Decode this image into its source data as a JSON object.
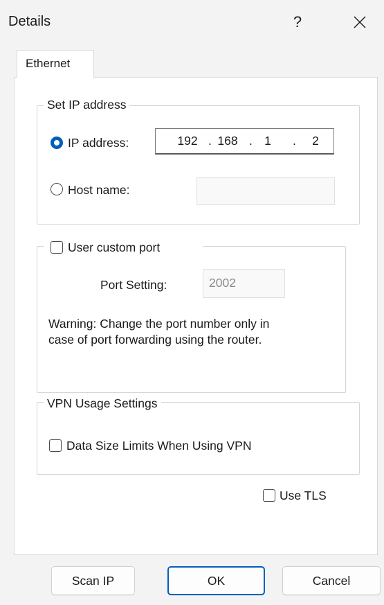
{
  "window": {
    "title": "Details",
    "help_label": "?"
  },
  "tabs": [
    {
      "label": "Ethernet",
      "selected": true
    }
  ],
  "set_ip": {
    "legend": "Set IP address",
    "ip_option": {
      "label": "IP address:",
      "selected": true
    },
    "ip_octets": [
      "192",
      "168",
      "1",
      "2"
    ],
    "ip_separator": ".",
    "host_option": {
      "label": "Host name:",
      "selected": false
    },
    "host_value": ""
  },
  "custom_port": {
    "checkbox_label": "User custom port",
    "checked": false,
    "port_label": "Port Setting:",
    "port_value": "2002",
    "warning_line1": "Warning: Change the port number only in",
    "warning_line2": "case of port forwarding using the router."
  },
  "vpn": {
    "legend": "VPN Usage Settings",
    "checkbox_label": "Data Size Limits When Using VPN",
    "checked": false
  },
  "tls": {
    "checkbox_label": "Use TLS",
    "checked": false
  },
  "buttons": {
    "scan_ip": "Scan IP",
    "ok": "OK",
    "cancel": "Cancel"
  },
  "colors": {
    "accent": "#005fb8",
    "background": "#f3f3f3",
    "panel": "#ffffff"
  },
  "icons": {
    "close": "close-icon"
  }
}
